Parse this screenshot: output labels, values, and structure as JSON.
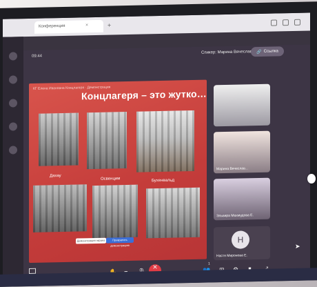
{
  "browser": {
    "tab_title": "Конференция",
    "tab_close": "×",
    "new_tab": "+"
  },
  "meeting": {
    "time": "09:44",
    "host_label": "Спикер: Марина Вячеславовна А.",
    "link_label": "Ссылка",
    "link_icon": "link-icon"
  },
  "slide": {
    "caption": "КГ Елена Ивановна Концлагеря · Демонстрация",
    "title": "Концлагеря – это жутко…",
    "photos": [
      {
        "caption": "Дахау"
      },
      {
        "caption": "Освенцим"
      },
      {
        "caption": "Бухенвальд"
      }
    ],
    "pill_left": "Демонстрация экрана",
    "pill_right": "Прекратить демонстрацию"
  },
  "participants": [
    {
      "name": ""
    },
    {
      "name": "Марина Вячеслав..."
    },
    {
      "name": "Эльвира Махмудова Е."
    },
    {
      "name": "Настя Миронова Е.",
      "avatar_initial": "Н"
    }
  ],
  "toolbar": {
    "hangup_icon": "close-icon",
    "hangup_label": "✕",
    "participants_count": "1"
  }
}
